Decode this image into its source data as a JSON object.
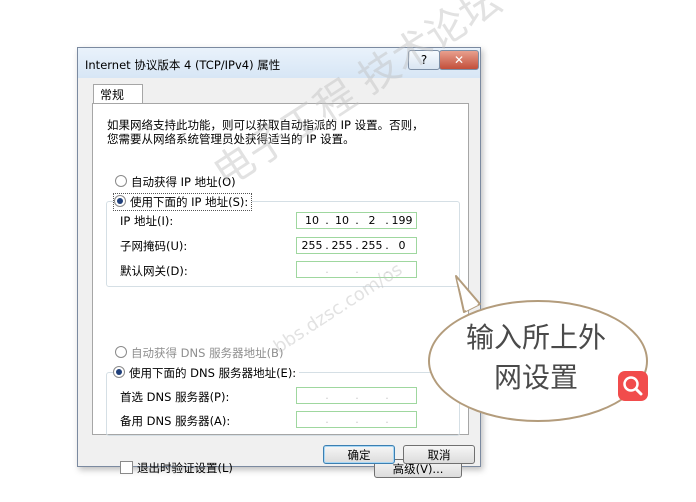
{
  "dialog": {
    "title": "Internet 协议版本 4 (TCP/IPv4) 属性",
    "help_symbol": "?",
    "close_symbol": "✕",
    "tab_general": "常规",
    "description_line1": "如果网络支持此功能，则可以获取自动指派的 IP 设置。否则，",
    "description_line2": "您需要从网络系统管理员处获得适当的 IP 设置。",
    "auto_ip_label": "自动获得 IP 地址(O)",
    "manual_ip_label": "使用下面的 IP 地址(S):",
    "ip_label": "IP 地址(I):",
    "ip_value": [
      "10",
      "10",
      "2",
      "199"
    ],
    "mask_label": "子网掩码(U):",
    "mask_value": [
      "255",
      "255",
      "255",
      "0"
    ],
    "gateway_label": "默认网关(D):",
    "auto_dns_label": "自动获得 DNS 服务器地址(B)",
    "manual_dns_label": "使用下面的 DNS 服务器地址(E):",
    "dns_primary_label": "首选 DNS 服务器(P):",
    "dns_secondary_label": "备用 DNS 服务器(A):",
    "validate_label": "退出时验证设置(L)",
    "advanced_label": "高级(V)...",
    "ok_label": "确定",
    "cancel_label": "取消"
  },
  "callout": {
    "line1": "输入所上外",
    "line2": "网设置"
  },
  "watermark": {
    "text": "电子工程 技术论坛",
    "url": "bbs.dzsc.com/os"
  },
  "colors": {
    "callout_border": "#b39c7c",
    "ip_box_border": "#9fd79f",
    "badge": "#f14c4c"
  }
}
